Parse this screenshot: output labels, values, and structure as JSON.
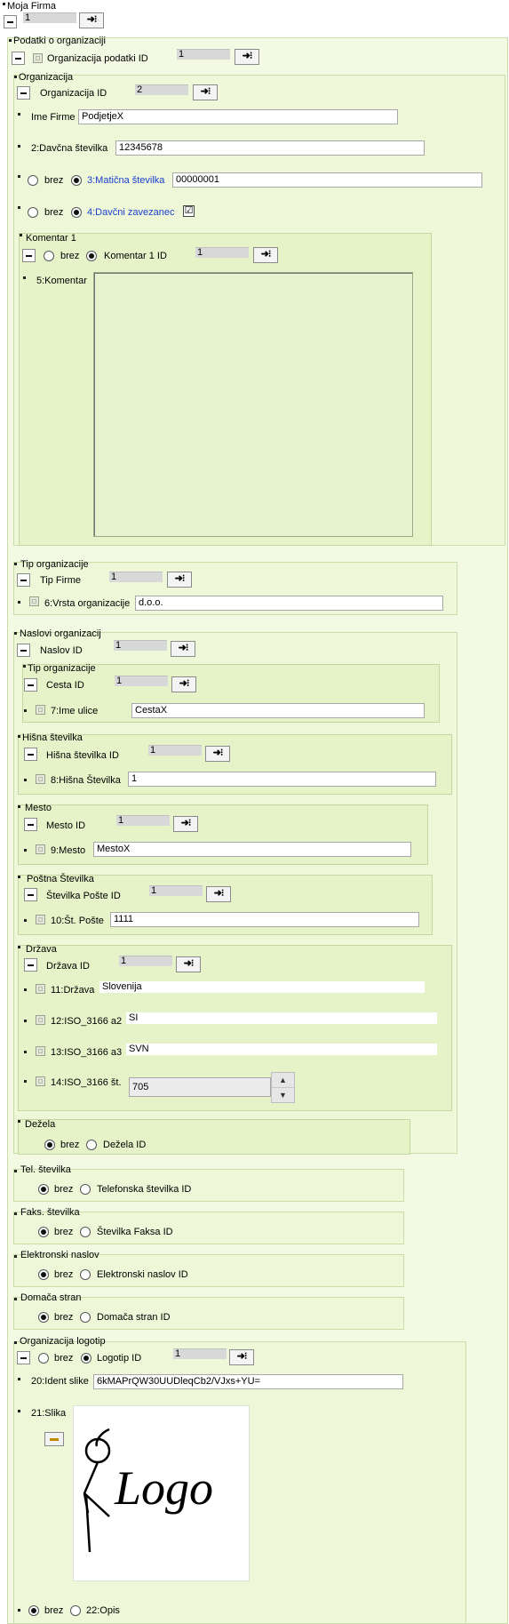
{
  "root": {
    "title": "Moja Firma",
    "id_value": "1"
  },
  "podatki": {
    "title": "Podatki o organizaciji",
    "id_label": "Organizacija podatki ID",
    "id_value": "1"
  },
  "organizacija": {
    "title": "Organizacija",
    "id_label": "Organizacija ID",
    "id_value": "2",
    "ime_label": "Ime Firme",
    "ime_value": "PodjetjeX",
    "davcna_label": "2:Davčna številka",
    "davcna_value": "12345678",
    "brez": "brez",
    "maticna_label": "3:Matična številka",
    "maticna_value": "00000001",
    "zavezanec_label": "4:Davčni zavezanec",
    "zavezanec_checked": "☑",
    "komentar": {
      "title": "Komentar 1",
      "id_label": "Komentar 1 ID",
      "id_value": "1",
      "field_label": "5:Komentar",
      "field_value": ""
    }
  },
  "tip": {
    "title": "Tip organizacije",
    "id_label": "Tip Firme",
    "id_value": "1",
    "field_label": "6:Vrsta organizacije",
    "field_value": "d.o.o."
  },
  "naslovi": {
    "title": "Naslovi organizacij",
    "id_label": "Naslov ID",
    "id_value": "1",
    "cesta": {
      "title": "Tip organizacije",
      "id_label": "Cesta ID",
      "id_value": "1",
      "field_label": "7:Ime ulice",
      "field_value": "CestaX"
    },
    "hisna": {
      "title": "Hišna številka",
      "id_label": "Hišna številka ID",
      "id_value": "1",
      "field_label": "8:Hišna Številka",
      "field_value": "1"
    },
    "mesto": {
      "title": "Mesto",
      "id_label": "Mesto ID",
      "id_value": "1",
      "field_label": "9:Mesto",
      "field_value": "MestoX"
    },
    "posta": {
      "title": "Poštna Številka",
      "id_label": "Številka Pošte ID",
      "id_value": "1",
      "field_label": "10:Št. Pošte",
      "field_value": "1111"
    },
    "drzava": {
      "title": "Država",
      "id_label": "Država ID",
      "id_value": "1",
      "f11_label": "11:Država",
      "f11_value": "Slovenija",
      "f12_label": "12:ISO_3166 a2",
      "f12_value": "SI",
      "f13_label": "13:ISO_3166 a3",
      "f13_value": "SVN",
      "f14_label": "14:ISO_3166 št.",
      "f14_value": "705"
    },
    "dezela": {
      "title": "Dežela",
      "brez": "brez",
      "option": "Dežela ID"
    }
  },
  "tel": {
    "title": "Tel. številka",
    "brez": "brez",
    "option": "Telefonska številka ID"
  },
  "faks": {
    "title": "Faks. številka",
    "brez": "brez",
    "option": "Številka Faksa ID"
  },
  "email": {
    "title": "Elektronski naslov",
    "brez": "brez",
    "option": "Elektronski naslov ID"
  },
  "web": {
    "title": "Domača stran",
    "brez": "brez",
    "option": "Domača stran ID"
  },
  "logotip": {
    "title": "Organizacija logotip",
    "brez": "brez",
    "id_label": "Logotip ID",
    "id_value": "1",
    "ident_label": "20:Ident slike",
    "ident_value": "6kMAPrQW30UUDleqCb2/VJxs+YU=",
    "slika_label": "21:Slika",
    "logo_text": "Logo",
    "opis_brez": "brez",
    "opis_label": "22:Opis"
  },
  "icons": {
    "go": "navigate-arrow-icon",
    "folder": "folder-open-icon"
  },
  "colors": {
    "panel": "#eef7d8",
    "link": "#1a3fd0"
  }
}
